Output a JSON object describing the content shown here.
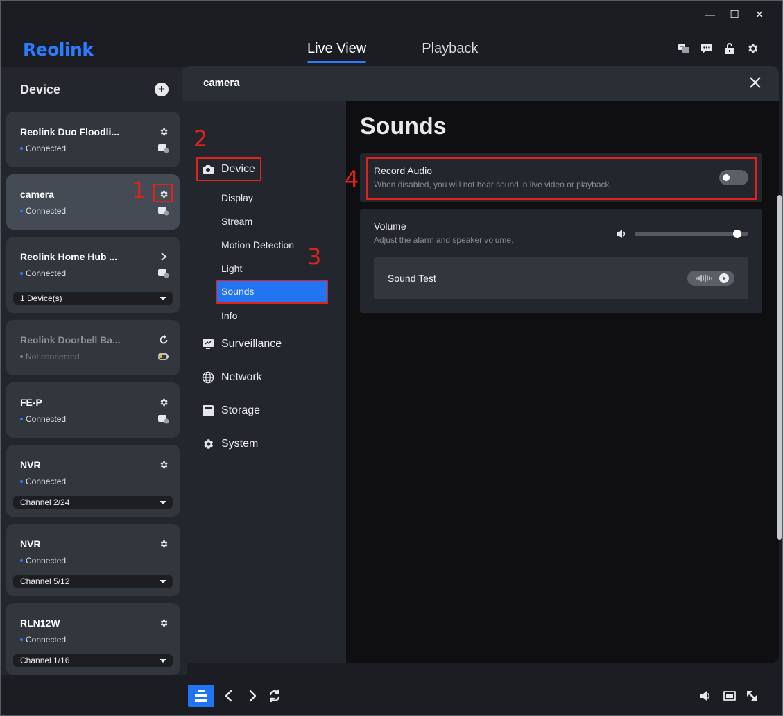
{
  "app": {
    "logo": "Reolink",
    "tabs": [
      {
        "label": "Live View",
        "active": true
      },
      {
        "label": "Playback",
        "active": false
      }
    ],
    "window_controls": {
      "minimize": "—",
      "maximize": "☐",
      "close": "✕"
    },
    "accent_color": "#2b7cff"
  },
  "sidebar": {
    "title": "Device",
    "devices": [
      {
        "name": "Reolink Duo Floodli...",
        "status": "Connected",
        "action_icon": "gear-icon"
      },
      {
        "name": "camera",
        "status": "Connected",
        "action_icon": "gear-icon",
        "selected": true
      },
      {
        "name": "Reolink Home Hub ...",
        "status": "Connected",
        "action_icon": "chevron-right-icon",
        "select": "1 Device(s)"
      },
      {
        "name": "Reolink Doorbell Ba...",
        "status": "Not connected",
        "action_icon": "refresh-icon"
      },
      {
        "name": "FE-P",
        "status": "Connected",
        "action_icon": "gear-icon"
      },
      {
        "name": "NVR",
        "status": "Connected",
        "action_icon": "gear-icon",
        "select": "Channel 2/24"
      },
      {
        "name": "NVR",
        "status": "Connected",
        "action_icon": "gear-icon",
        "select": "Channel 5/12"
      },
      {
        "name": "RLN12W",
        "status": "Connected",
        "action_icon": "gear-icon",
        "select": "Channel 1/16"
      }
    ]
  },
  "annotations": [
    "1",
    "2",
    "3",
    "4"
  ],
  "panel": {
    "title": "camera",
    "nav": {
      "device": "Device",
      "device_items": [
        "Display",
        "Stream",
        "Motion Detection",
        "Light",
        "Sounds",
        "Info"
      ],
      "active_item": "Sounds",
      "surveillance": "Surveillance",
      "network": "Network",
      "storage": "Storage",
      "system": "System"
    },
    "content": {
      "page_title": "Sounds",
      "record_audio": {
        "title": "Record Audio",
        "description": "When disabled, you will not hear sound in live video or playback.",
        "enabled": false
      },
      "volume": {
        "title": "Volume",
        "description": "Adjust the alarm and speaker volume.",
        "level": 0.9
      },
      "sound_test": {
        "label": "Sound Test"
      }
    }
  },
  "annotation_color": "#e0221c",
  "active_nav_color": "#2174f2"
}
